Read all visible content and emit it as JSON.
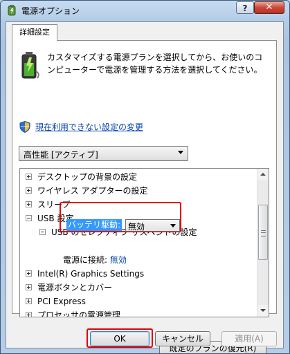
{
  "window": {
    "title": "電源オプション",
    "help_label": "?",
    "close_label": "✕"
  },
  "tab": {
    "label": "詳細設定"
  },
  "description": "カスタマイズする電源プランを選択してから、お使いのコンピューターで電源を管理する方法を選択してください。",
  "link": {
    "label": "現在利用できない設定の変更"
  },
  "plan_select": {
    "value": "高性能 [アクティブ]"
  },
  "tree": {
    "items": [
      {
        "label": "デスクトップの背景の設定",
        "state": "collapsed"
      },
      {
        "label": "ワイヤレス アダプターの設定",
        "state": "collapsed"
      },
      {
        "label": "スリープ",
        "state": "collapsed"
      },
      {
        "label": "USB 設定",
        "state": "expanded"
      },
      {
        "label": "USB のセレクティブ サスペンドの設定",
        "state": "expanded"
      },
      {
        "label": "Intel(R) Graphics Settings",
        "state": "collapsed"
      },
      {
        "label": "電源ボタンとカバー",
        "state": "collapsed"
      },
      {
        "label": "PCI Express",
        "state": "collapsed"
      },
      {
        "label": "プロセッサの電源管理",
        "state": "collapsed"
      }
    ],
    "battery": {
      "label": "バッテリ駆動:",
      "value": "無効"
    },
    "plugged_in": {
      "label": "電源に接続:",
      "value": "無効"
    }
  },
  "buttons": {
    "restore": "既定のプランの復元(R)",
    "ok": "OK",
    "cancel": "キャンセル",
    "apply": "適用(A)"
  },
  "colors": {
    "highlight": "#3399ff",
    "annotation": "#e00000",
    "link": "#0645ad"
  }
}
